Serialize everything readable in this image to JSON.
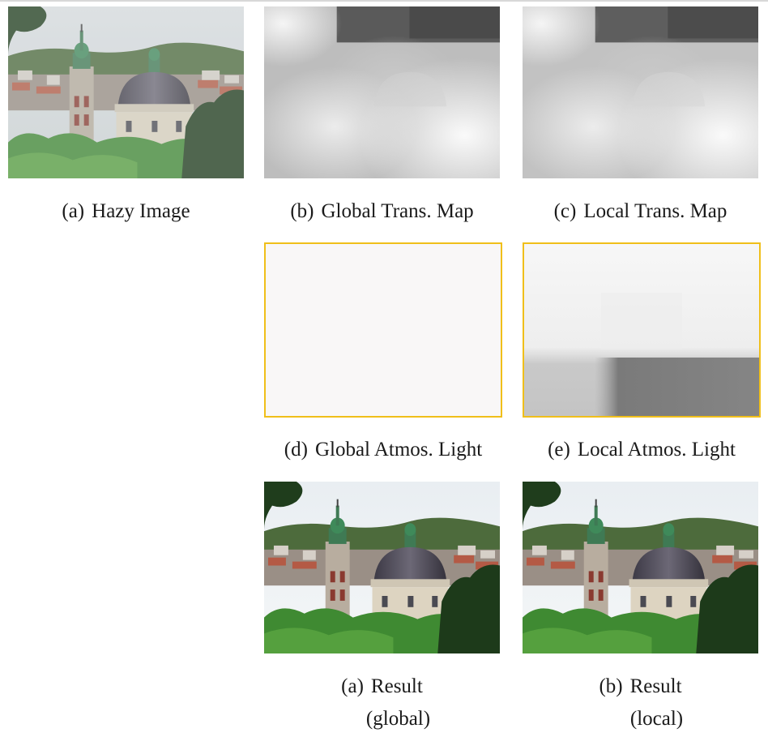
{
  "figure": {
    "panels": [
      {
        "id": "hazy",
        "tag": "(a)",
        "label": "Hazy Image"
      },
      {
        "id": "global_trans",
        "tag": "(b)",
        "label": "Global Trans. Map"
      },
      {
        "id": "local_trans",
        "tag": "(c)",
        "label": "Local Trans. Map"
      },
      {
        "id": "global_atmos",
        "tag": "(d)",
        "label": "Global Atmos. Light"
      },
      {
        "id": "local_atmos",
        "tag": "(e)",
        "label": "Local Atmos. Light"
      },
      {
        "id": "result_global",
        "tag": "(a)",
        "label": "Result",
        "sublabel": "(global)"
      },
      {
        "id": "result_local",
        "tag": "(b)",
        "label": "Result",
        "sublabel": "(local)"
      }
    ],
    "atmos_frame_color": "#f0bf1a"
  }
}
